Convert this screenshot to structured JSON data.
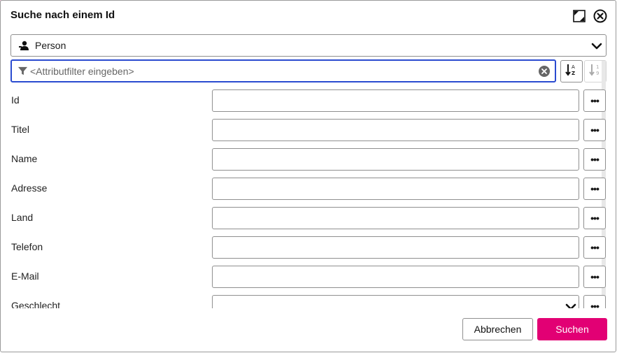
{
  "dialog": {
    "title": "Suche nach einem Id",
    "icons": [
      "maximize-icon",
      "close-circle-icon"
    ]
  },
  "type_select": {
    "icon": "person-icon",
    "value": "Person"
  },
  "filter": {
    "placeholder": "<Attributfilter eingeben>",
    "icon": "filter-funnel-icon"
  },
  "sort_buttons": {
    "alpha_icon": "sort-alpha-icon",
    "numeric_icon": "sort-numeric-icon"
  },
  "fields": [
    {
      "label": "Id",
      "value": "",
      "type": "text"
    },
    {
      "label": "Titel",
      "value": "",
      "type": "text"
    },
    {
      "label": "Name",
      "value": "",
      "type": "text"
    },
    {
      "label": "Adresse",
      "value": "",
      "type": "text"
    },
    {
      "label": "Land",
      "value": "",
      "type": "text"
    },
    {
      "label": "Telefon",
      "value": "",
      "type": "text"
    },
    {
      "label": "E-Mail",
      "value": "",
      "type": "text"
    },
    {
      "label": "Geschlecht",
      "value": "",
      "type": "select"
    }
  ],
  "more_button_label": "•••",
  "buttons": {
    "cancel": "Abbrechen",
    "search": "Suchen"
  },
  "colors": {
    "accent": "#e20074",
    "focus": "#2a4bd0"
  }
}
